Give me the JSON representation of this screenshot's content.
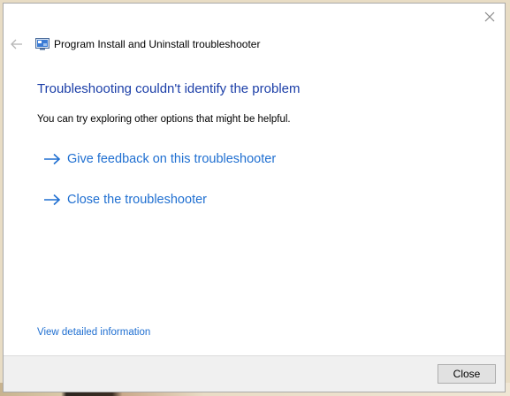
{
  "window": {
    "title": "Program Install and Uninstall troubleshooter"
  },
  "content": {
    "heading": "Troubleshooting couldn't identify the problem",
    "subtext": "You can try exploring other options that might be helpful.",
    "options": [
      {
        "label": "Give feedback on this troubleshooter"
      },
      {
        "label": "Close the troubleshooter"
      }
    ],
    "details_link": "View detailed information"
  },
  "footer": {
    "close_label": "Close"
  },
  "colors": {
    "heading": "#1c3fa8",
    "link": "#1f6fd1",
    "footer_bg": "#f0f0f0"
  },
  "icons": {
    "back": "back-arrow-icon",
    "close": "close-icon",
    "title": "troubleshooter-app-icon",
    "option": "right-arrow-icon"
  }
}
